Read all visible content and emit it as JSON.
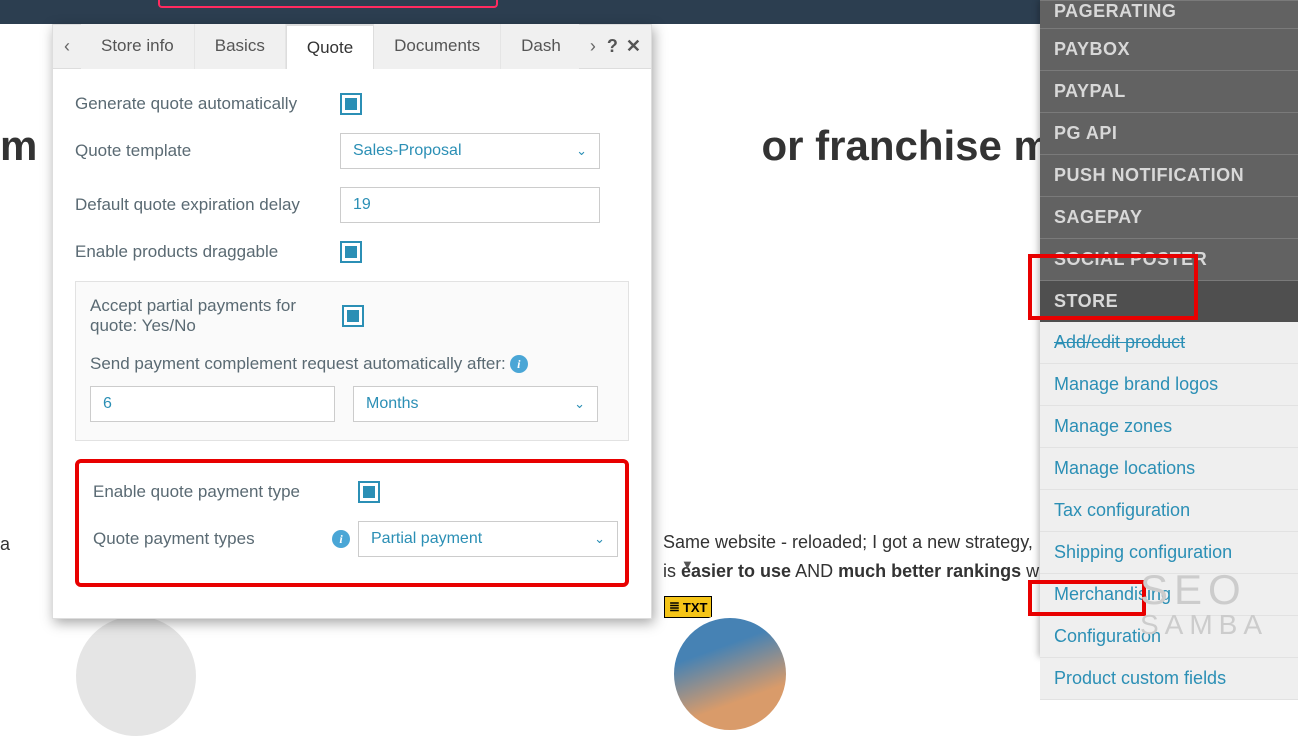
{
  "background": {
    "heading_prefix": "m",
    "heading_suffix": "or franchise marketi",
    "line1_a": "Same website - reloaded; I got a new strategy,",
    "line2_a": "is ",
    "line2_b": "easier to use",
    "line2_c": " AND ",
    "line2_d": "much better rankings",
    "line2_e": " w",
    "a_char": "a",
    "txt_label": "TXT"
  },
  "tabs": {
    "items": [
      "Store info",
      "Basics",
      "Quote",
      "Documents",
      "Dash"
    ],
    "active_index": 2
  },
  "form": {
    "generate_label": "Generate quote automatically",
    "template_label": "Quote template",
    "template_value": "Sales-Proposal",
    "expiration_label": "Default quote expiration delay",
    "expiration_value": "19",
    "draggable_label": "Enable products draggable",
    "partial_label": "Accept partial payments for quote: Yes/No",
    "send_after_label": "Send payment complement request automatically after:",
    "send_after_value": "6",
    "send_after_unit": "Months",
    "enable_payment_type_label": "Enable quote payment type",
    "payment_types_label": "Quote payment types",
    "payment_types_value": "Partial payment"
  },
  "right_menu": {
    "headers": [
      "PAGERATING",
      "PAYBOX",
      "PAYPAL",
      "PG API",
      "PUSH NOTIFICATION",
      "SAGEPAY",
      "SOCIAL POSTER",
      "STORE"
    ],
    "store_items": [
      "Add/edit product",
      "Manage brand logos",
      "Manage zones",
      "Manage locations",
      "Tax configuration",
      "Shipping configuration",
      "Merchandising",
      "Configuration",
      "Product custom fields"
    ]
  },
  "logo": {
    "l1": "SEO",
    "l2": "SAMBA"
  }
}
